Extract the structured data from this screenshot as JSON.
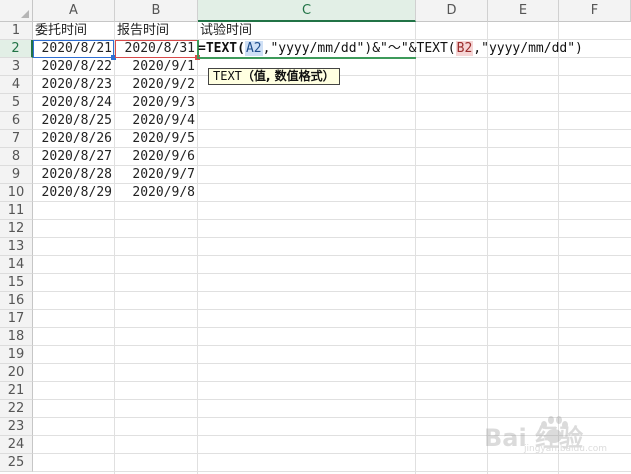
{
  "columns": [
    "A",
    "B",
    "C",
    "D",
    "E",
    "F"
  ],
  "rows": [
    "1",
    "2",
    "3",
    "4",
    "5",
    "6",
    "7",
    "8",
    "9",
    "10",
    "11",
    "12",
    "13",
    "14",
    "15",
    "16",
    "17",
    "18",
    "19",
    "20",
    "21",
    "22",
    "23",
    "24",
    "25"
  ],
  "headers": {
    "a1": "委托时间",
    "b1": "报告时间",
    "c1": "试验时间"
  },
  "data_rows": [
    {
      "a": "2020/8/21",
      "b": "2020/8/31"
    },
    {
      "a": "2020/8/22",
      "b": "2020/9/1"
    },
    {
      "a": "2020/8/23",
      "b": "2020/9/2"
    },
    {
      "a": "2020/8/24",
      "b": "2020/9/3"
    },
    {
      "a": "2020/8/25",
      "b": "2020/9/4"
    },
    {
      "a": "2020/8/26",
      "b": "2020/9/5"
    },
    {
      "a": "2020/8/27",
      "b": "2020/9/6"
    },
    {
      "a": "2020/8/28",
      "b": "2020/9/7"
    },
    {
      "a": "2020/8/29",
      "b": "2020/9/8"
    }
  ],
  "formula": {
    "p1": "=TEXT(",
    "ref1": "A2",
    "p2": ",\"yyyy/mm/dd\")&\"～\"&TEXT(",
    "ref2": "B2",
    "p3": ",\"yyyy/mm/dd\")"
  },
  "tooltip": {
    "fn": "TEXT",
    "args": "（值, 数值格式）"
  },
  "active_column": "C",
  "active_row": "2",
  "colors": {
    "accent": "#217346",
    "ref_a": "#2f6fd3",
    "ref_b": "#d84b4b"
  },
  "watermark": {
    "text": "Bai 经验",
    "sub": "jingyan.baidu.com"
  }
}
